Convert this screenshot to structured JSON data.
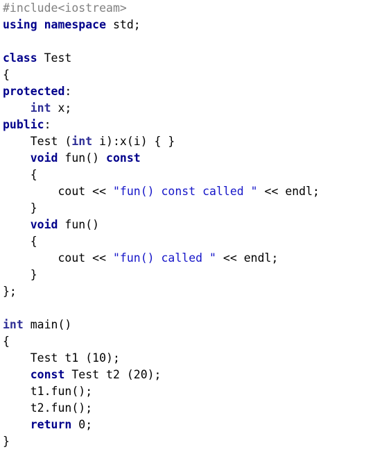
{
  "colors": {
    "background": "#ffffff",
    "keyword": "#00008b",
    "preprocessor": "#808080",
    "string": "#1515c8",
    "plain": "#000000"
  },
  "code_lines": [
    [
      {
        "t": "pp",
        "v": "#include<iostream>"
      }
    ],
    [
      {
        "t": "kw",
        "v": "using"
      },
      {
        "t": "plain",
        "v": " "
      },
      {
        "t": "kw",
        "v": "namespace"
      },
      {
        "t": "plain",
        "v": " std;"
      }
    ],
    [],
    [
      {
        "t": "kw",
        "v": "class"
      },
      {
        "t": "plain",
        "v": " Test"
      }
    ],
    [
      {
        "t": "plain",
        "v": "{"
      }
    ],
    [
      {
        "t": "kw",
        "v": "protected"
      },
      {
        "t": "plain",
        "v": ":"
      }
    ],
    [
      {
        "t": "plain",
        "v": "    "
      },
      {
        "t": "type",
        "v": "int"
      },
      {
        "t": "plain",
        "v": " x;"
      }
    ],
    [
      {
        "t": "kw",
        "v": "public"
      },
      {
        "t": "plain",
        "v": ":"
      }
    ],
    [
      {
        "t": "plain",
        "v": "    Test ("
      },
      {
        "t": "type",
        "v": "int"
      },
      {
        "t": "plain",
        "v": " i):x(i) { }"
      }
    ],
    [
      {
        "t": "plain",
        "v": "    "
      },
      {
        "t": "kw",
        "v": "void"
      },
      {
        "t": "plain",
        "v": " fun() "
      },
      {
        "t": "kw",
        "v": "const"
      }
    ],
    [
      {
        "t": "plain",
        "v": "    {"
      }
    ],
    [
      {
        "t": "plain",
        "v": "        cout << "
      },
      {
        "t": "str",
        "v": "\"fun() const called \""
      },
      {
        "t": "plain",
        "v": " << endl;"
      }
    ],
    [
      {
        "t": "plain",
        "v": "    }"
      }
    ],
    [
      {
        "t": "plain",
        "v": "    "
      },
      {
        "t": "kw",
        "v": "void"
      },
      {
        "t": "plain",
        "v": " fun()"
      }
    ],
    [
      {
        "t": "plain",
        "v": "    {"
      }
    ],
    [
      {
        "t": "plain",
        "v": "        cout << "
      },
      {
        "t": "str",
        "v": "\"fun() called \""
      },
      {
        "t": "plain",
        "v": " << endl;"
      }
    ],
    [
      {
        "t": "plain",
        "v": "    }"
      }
    ],
    [
      {
        "t": "plain",
        "v": "};"
      }
    ],
    [],
    [
      {
        "t": "type",
        "v": "int"
      },
      {
        "t": "plain",
        "v": " main()"
      }
    ],
    [
      {
        "t": "plain",
        "v": "{"
      }
    ],
    [
      {
        "t": "plain",
        "v": "    Test t1 (10);"
      }
    ],
    [
      {
        "t": "plain",
        "v": "    "
      },
      {
        "t": "kw",
        "v": "const"
      },
      {
        "t": "plain",
        "v": " Test t2 (20);"
      }
    ],
    [
      {
        "t": "plain",
        "v": "    t1.fun();"
      }
    ],
    [
      {
        "t": "plain",
        "v": "    t2.fun();"
      }
    ],
    [
      {
        "t": "plain",
        "v": "    "
      },
      {
        "t": "kw",
        "v": "return"
      },
      {
        "t": "plain",
        "v": " 0;"
      }
    ],
    [
      {
        "t": "plain",
        "v": "}"
      }
    ]
  ]
}
